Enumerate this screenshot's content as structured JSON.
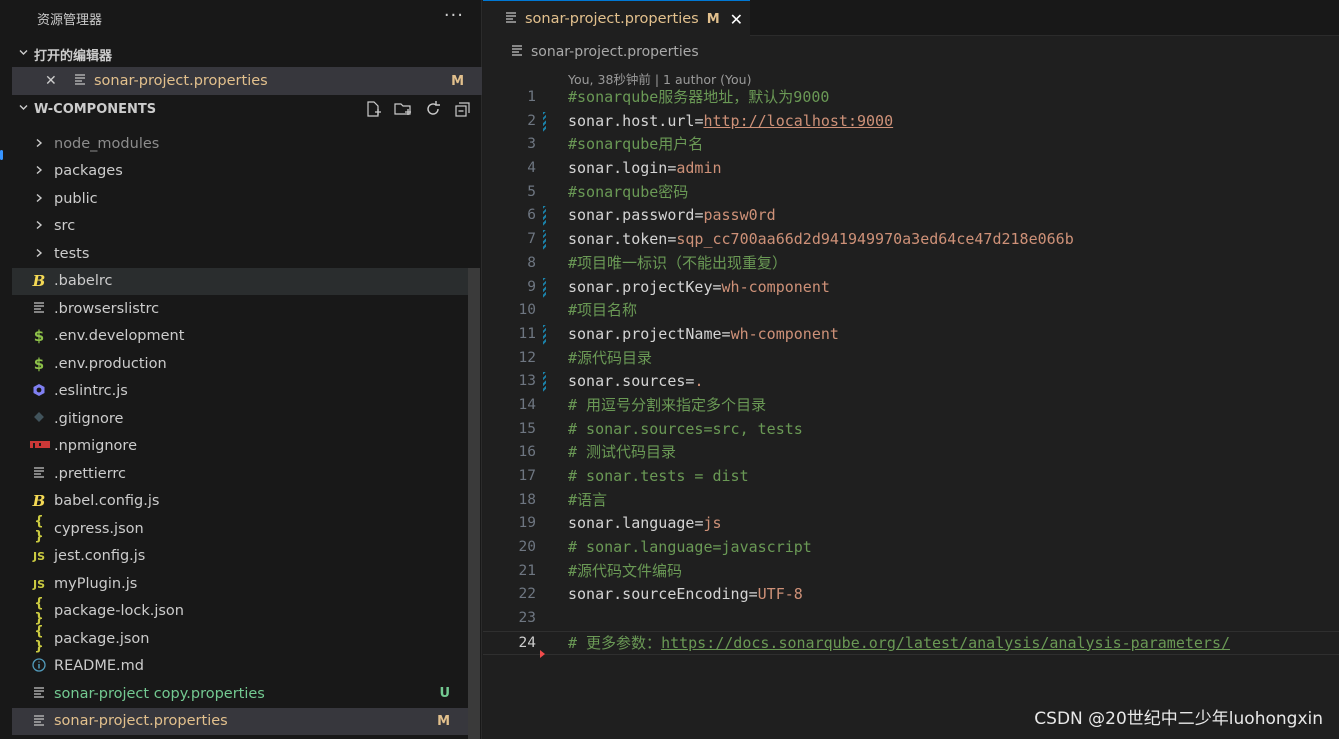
{
  "explorer": {
    "title": "资源管理器",
    "more": "···",
    "open_editors_label": "打开的编辑器",
    "open_editor": {
      "name": "sonar-project.properties",
      "badge": "M"
    },
    "project_label": "W-COMPONENTS",
    "files": [
      {
        "name": "node_modules",
        "type": "folder",
        "dim": true
      },
      {
        "name": "packages",
        "type": "folder"
      },
      {
        "name": "public",
        "type": "folder"
      },
      {
        "name": "src",
        "type": "folder"
      },
      {
        "name": "tests",
        "type": "folder"
      },
      {
        "name": ".babelrc",
        "icon": "babel",
        "selected": true
      },
      {
        "name": ".browserslistrc",
        "icon": "lines"
      },
      {
        "name": ".env.development",
        "icon": "dollar"
      },
      {
        "name": ".env.production",
        "icon": "dollar"
      },
      {
        "name": ".eslintrc.js",
        "icon": "eslint"
      },
      {
        "name": ".gitignore",
        "icon": "git"
      },
      {
        "name": ".npmignore",
        "icon": "npm"
      },
      {
        "name": ".prettierrc",
        "icon": "lines"
      },
      {
        "name": "babel.config.js",
        "icon": "babel"
      },
      {
        "name": "cypress.json",
        "icon": "json"
      },
      {
        "name": "jest.config.js",
        "icon": "js"
      },
      {
        "name": "myPlugin.js",
        "icon": "js"
      },
      {
        "name": "package-lock.json",
        "icon": "json"
      },
      {
        "name": "package.json",
        "icon": "json"
      },
      {
        "name": "README.md",
        "icon": "info"
      },
      {
        "name": "sonar-project copy.properties",
        "icon": "lines",
        "status": "U"
      },
      {
        "name": "sonar-project.properties",
        "icon": "lines",
        "status": "M",
        "active": true
      }
    ]
  },
  "editor": {
    "tab": {
      "name": "sonar-project.properties",
      "badge": "M",
      "close": "✕"
    },
    "breadcrumb": "sonar-project.properties",
    "blame": "You, 38秒钟前 | 1 author (You)",
    "current_line": 24,
    "lines": [
      {
        "n": 1,
        "kind": "comment",
        "text": "#sonarqube服务器地址，默认为9000"
      },
      {
        "n": 2,
        "kind": "prop",
        "key": "sonar.host.url",
        "value": "http://localhost:9000",
        "link": true,
        "gutter": true
      },
      {
        "n": 3,
        "kind": "comment",
        "text": "#sonarqube用户名"
      },
      {
        "n": 4,
        "kind": "prop",
        "key": "sonar.login",
        "value": "admin"
      },
      {
        "n": 5,
        "kind": "comment",
        "text": "#sonarqube密码"
      },
      {
        "n": 6,
        "kind": "prop",
        "key": "sonar.password",
        "value": "passw0rd",
        "gutter": true
      },
      {
        "n": 7,
        "kind": "prop",
        "key": "sonar.token",
        "value": "sqp_cc700aa66d2d941949970a3ed64ce47d218e066b",
        "gutter": true
      },
      {
        "n": 8,
        "kind": "comment",
        "text": "#项目唯一标识（不能出现重复）"
      },
      {
        "n": 9,
        "kind": "prop",
        "key": "sonar.projectKey",
        "value": "wh-component",
        "gutter": true
      },
      {
        "n": 10,
        "kind": "comment",
        "text": "#项目名称"
      },
      {
        "n": 11,
        "kind": "prop",
        "key": "sonar.projectName",
        "value": "wh-component",
        "gutter": true
      },
      {
        "n": 12,
        "kind": "comment",
        "text": "#源代码目录"
      },
      {
        "n": 13,
        "kind": "prop",
        "key": "sonar.sources",
        "value": ".",
        "gutter": true
      },
      {
        "n": 14,
        "kind": "comment",
        "text": "# 用逗号分割来指定多个目录"
      },
      {
        "n": 15,
        "kind": "comment",
        "text": "# sonar.sources=src, tests"
      },
      {
        "n": 16,
        "kind": "comment",
        "text": "# 测试代码目录"
      },
      {
        "n": 17,
        "kind": "comment",
        "text": "# sonar.tests = dist"
      },
      {
        "n": 18,
        "kind": "comment",
        "text": "#语言"
      },
      {
        "n": 19,
        "kind": "prop",
        "key": "sonar.language",
        "value": "js"
      },
      {
        "n": 20,
        "kind": "comment",
        "text": "# sonar.language=javascript"
      },
      {
        "n": 21,
        "kind": "comment",
        "text": "#源代码文件编码"
      },
      {
        "n": 22,
        "kind": "prop",
        "key": "sonar.sourceEncoding",
        "value": "UTF-8"
      },
      {
        "n": 23,
        "kind": "empty",
        "text": ""
      },
      {
        "n": 24,
        "kind": "comment-link",
        "text": "# 更多参数：",
        "link": "https://docs.sonarqube.org/latest/analysis/analysis-parameters/",
        "deleted_marker": true
      }
    ]
  },
  "watermark": "CSDN @20世纪中二少年luohongxin",
  "colors": {
    "accent": "#0078d4",
    "modified": "#e2c08d",
    "untracked": "#73c991",
    "comment": "#6a9955",
    "value": "#ce9178"
  }
}
